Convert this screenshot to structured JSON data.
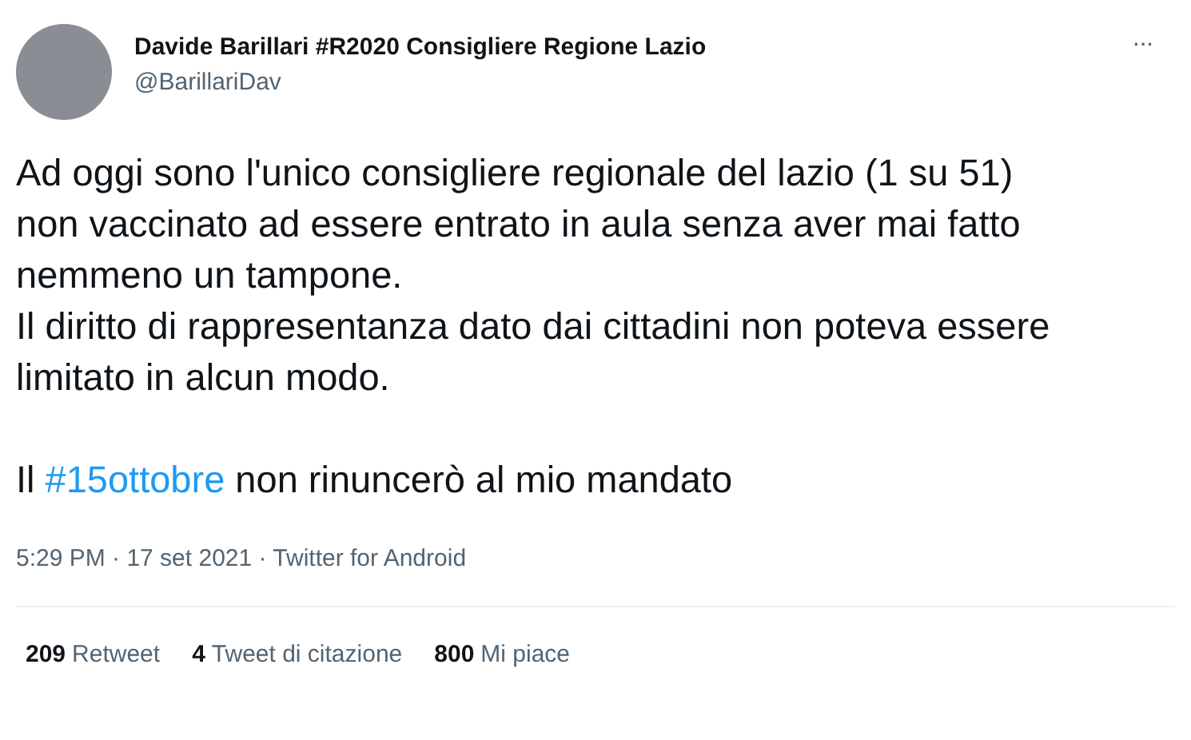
{
  "author": {
    "name": "Davide Barillari #R2020 Consigliere Regione Lazio",
    "handle": "@BarillariDav"
  },
  "more": "···",
  "paragraphs": [
    [
      [
        {
          "kind": "text",
          "text": "Ad oggi sono l'unico consigliere regionale del lazio (1 su 51) non vaccinato ad essere entrato in aula senza aver mai fatto nemmeno un tampone."
        }
      ],
      [
        {
          "kind": "text",
          "text": "Il diritto di rappresentanza dato dai cittadini non poteva essere limitato in alcun modo."
        }
      ]
    ],
    [
      [
        {
          "kind": "text",
          "text": "Il "
        },
        {
          "kind": "hashtag",
          "text": "#15ottobre"
        },
        {
          "kind": "text",
          "text": " non rinuncerò al mio mandato"
        }
      ]
    ]
  ],
  "meta": "5:29 PM · 17 set 2021 · Twitter for Android",
  "stats": [
    {
      "count": "209",
      "label": "Retweet"
    },
    {
      "count": "4",
      "label": "Tweet di citazione"
    },
    {
      "count": "800",
      "label": "Mi piace"
    }
  ]
}
